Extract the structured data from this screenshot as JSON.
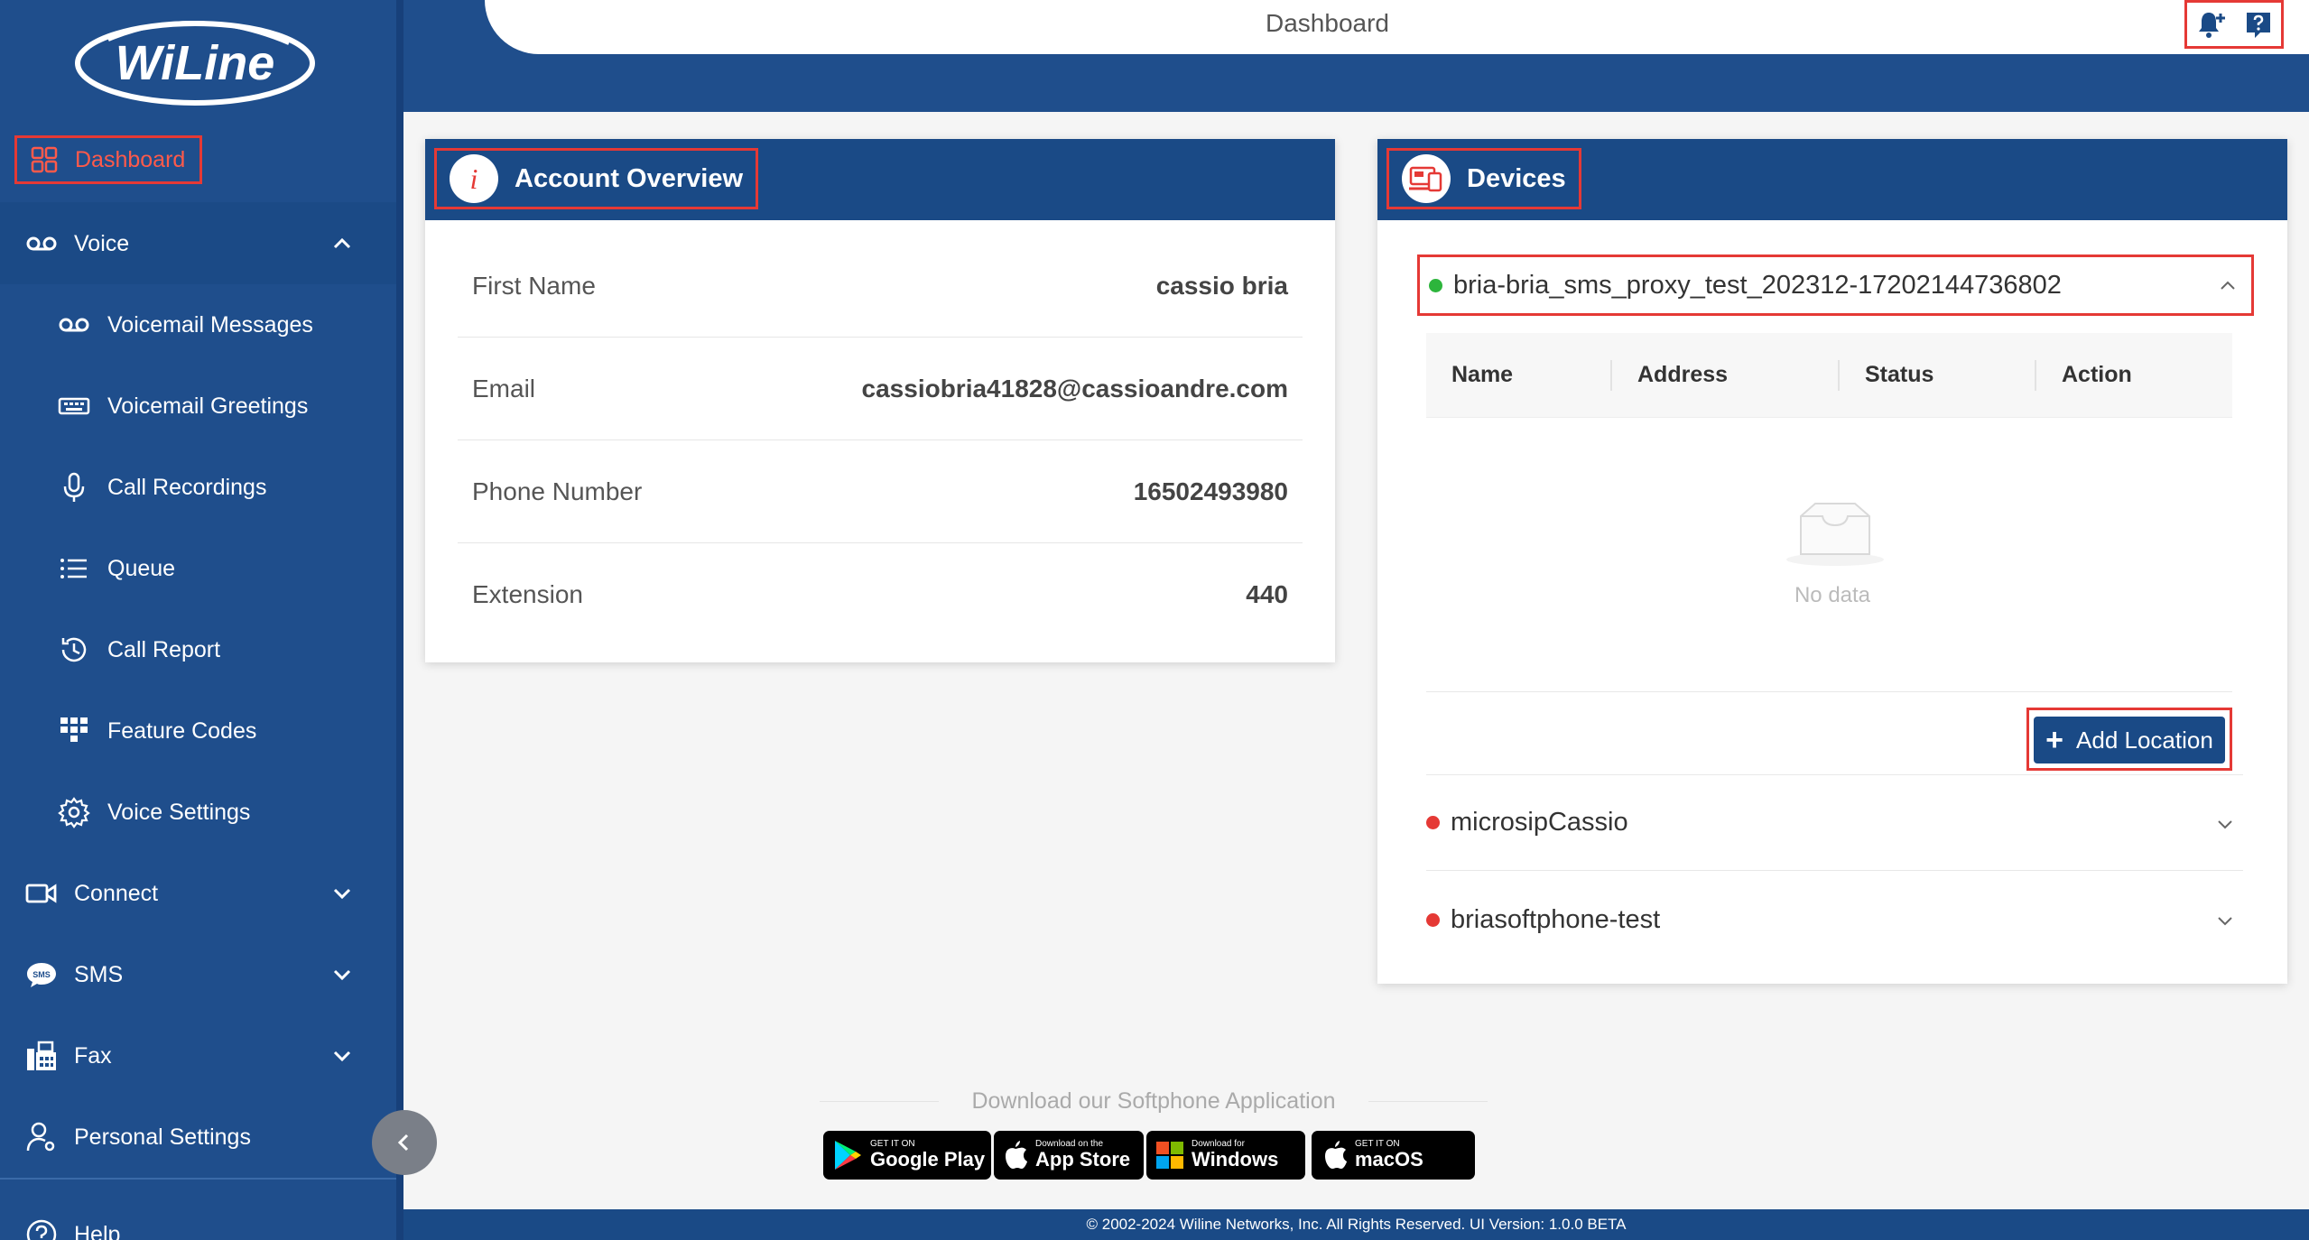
{
  "header": {
    "title": "Dashboard"
  },
  "sidebar": {
    "logo_text": "WiLine",
    "dashboard": "Dashboard",
    "voice": {
      "label": "Voice",
      "items": [
        {
          "label": "Voicemail Messages"
        },
        {
          "label": "Voicemail Greetings"
        },
        {
          "label": "Call Recordings"
        },
        {
          "label": "Queue"
        },
        {
          "label": "Call Report"
        },
        {
          "label": "Feature Codes"
        },
        {
          "label": "Voice Settings"
        }
      ]
    },
    "connect": "Connect",
    "sms": "SMS",
    "fax": "Fax",
    "personal_settings": "Personal Settings",
    "help": "Help"
  },
  "account": {
    "title": "Account Overview",
    "rows": [
      {
        "label": "First Name",
        "value": "cassio bria"
      },
      {
        "label": "Email",
        "value": "cassiobria41828@cassioandre.com"
      },
      {
        "label": "Phone Number",
        "value": "16502493980"
      },
      {
        "label": "Extension",
        "value": "440"
      }
    ]
  },
  "devices": {
    "title": "Devices",
    "expanded": {
      "name": "bria-bria_sms_proxy_test_202312-17202144736802",
      "status_color": "#2db53c",
      "columns": [
        "Name",
        "Address",
        "Status",
        "Action"
      ],
      "empty_text": "No data",
      "add_button": "Add Location"
    },
    "others": [
      {
        "name": "microsipCassio",
        "status_color": "#e53935"
      },
      {
        "name": "briasoftphone-test",
        "status_color": "#e53935"
      }
    ]
  },
  "downloads": {
    "title": "Download our Softphone Application",
    "stores": [
      {
        "small": "GET IT ON",
        "big": "Google Play"
      },
      {
        "small": "Download on the",
        "big": "App Store"
      },
      {
        "small": "Download for",
        "big": "Windows"
      },
      {
        "small": "GET IT ON",
        "big": "macOS"
      }
    ]
  },
  "footer": {
    "text": "© 2002-2024 Wiline Networks, Inc. All Rights Reserved. UI Version: 1.0.0 BETA"
  },
  "colors": {
    "primary": "#1f4e8c",
    "highlight": "#e53935",
    "online": "#2db53c",
    "offline": "#e53935"
  }
}
